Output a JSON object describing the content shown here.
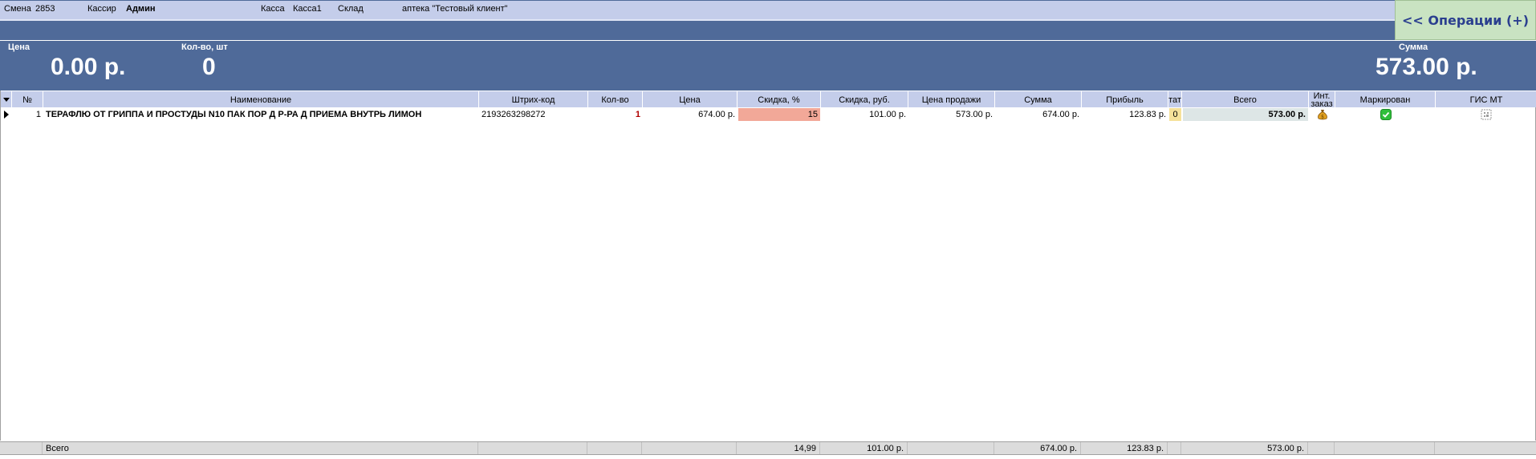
{
  "info": {
    "shift_label": "Смена",
    "shift_value": "2853",
    "cashier_label": "Кассир",
    "cashier_value": "Админ",
    "register_label": "Касса",
    "register_value": "Касса1",
    "warehouse_label": "Склад",
    "warehouse_value": "аптека \"Тестовый клиент\""
  },
  "operations_button": "<< Операции (+)",
  "totals": {
    "price_label": "Цена",
    "price_value": "0.00 р.",
    "qty_label": "Кол-во, шт",
    "qty_value": "0",
    "sum_label": "Сумма",
    "sum_value": "573.00 р."
  },
  "columns": {
    "num": "№",
    "name": "Наименование",
    "barcode": "Штрих-код",
    "qty": "Кол-во",
    "price": "Цена",
    "discount_pct": "Скидка, %",
    "discount_rub": "Скидка, руб.",
    "sale_price": "Цена продажи",
    "sum": "Сумма",
    "profit": "Прибыль",
    "tat": "тат",
    "total": "Всего",
    "int_order": "Инт. заказ",
    "marked": "Маркирован",
    "gis_mt": "ГИС МТ"
  },
  "rows": [
    {
      "num": "1",
      "name": "ТЕРАФЛЮ ОТ ГРИППА И ПРОСТУДЫ N10 ПАК ПОР Д Р-РА Д ПРИЕМА ВНУТРЬ ЛИМОН",
      "barcode": "2193263298272",
      "qty": "1",
      "price": "674.00 р.",
      "discount_pct": "15",
      "discount_rub": "101.00 р.",
      "sale_price": "573.00 р.",
      "sum": "674.00 р.",
      "profit": "123.83 р.",
      "tat": "0",
      "total": "573.00 р."
    }
  ],
  "footer": {
    "label": "Всего",
    "discount_pct": "14,99",
    "discount_rub": "101.00 р.",
    "sum": "674.00 р.",
    "profit": "123.83 р.",
    "total": "573.00 р."
  },
  "colors": {
    "panel": "#4f6a99",
    "header": "#c4cdea",
    "discount_cell": "#f2a898",
    "tat_cell": "#f5e19a",
    "total_cell": "#dde6e6",
    "qty_text": "#b00000"
  },
  "icons": {
    "int_order": "money-bag-icon",
    "marked": "check-icon",
    "gis_mt": "datamatrix-icon"
  }
}
